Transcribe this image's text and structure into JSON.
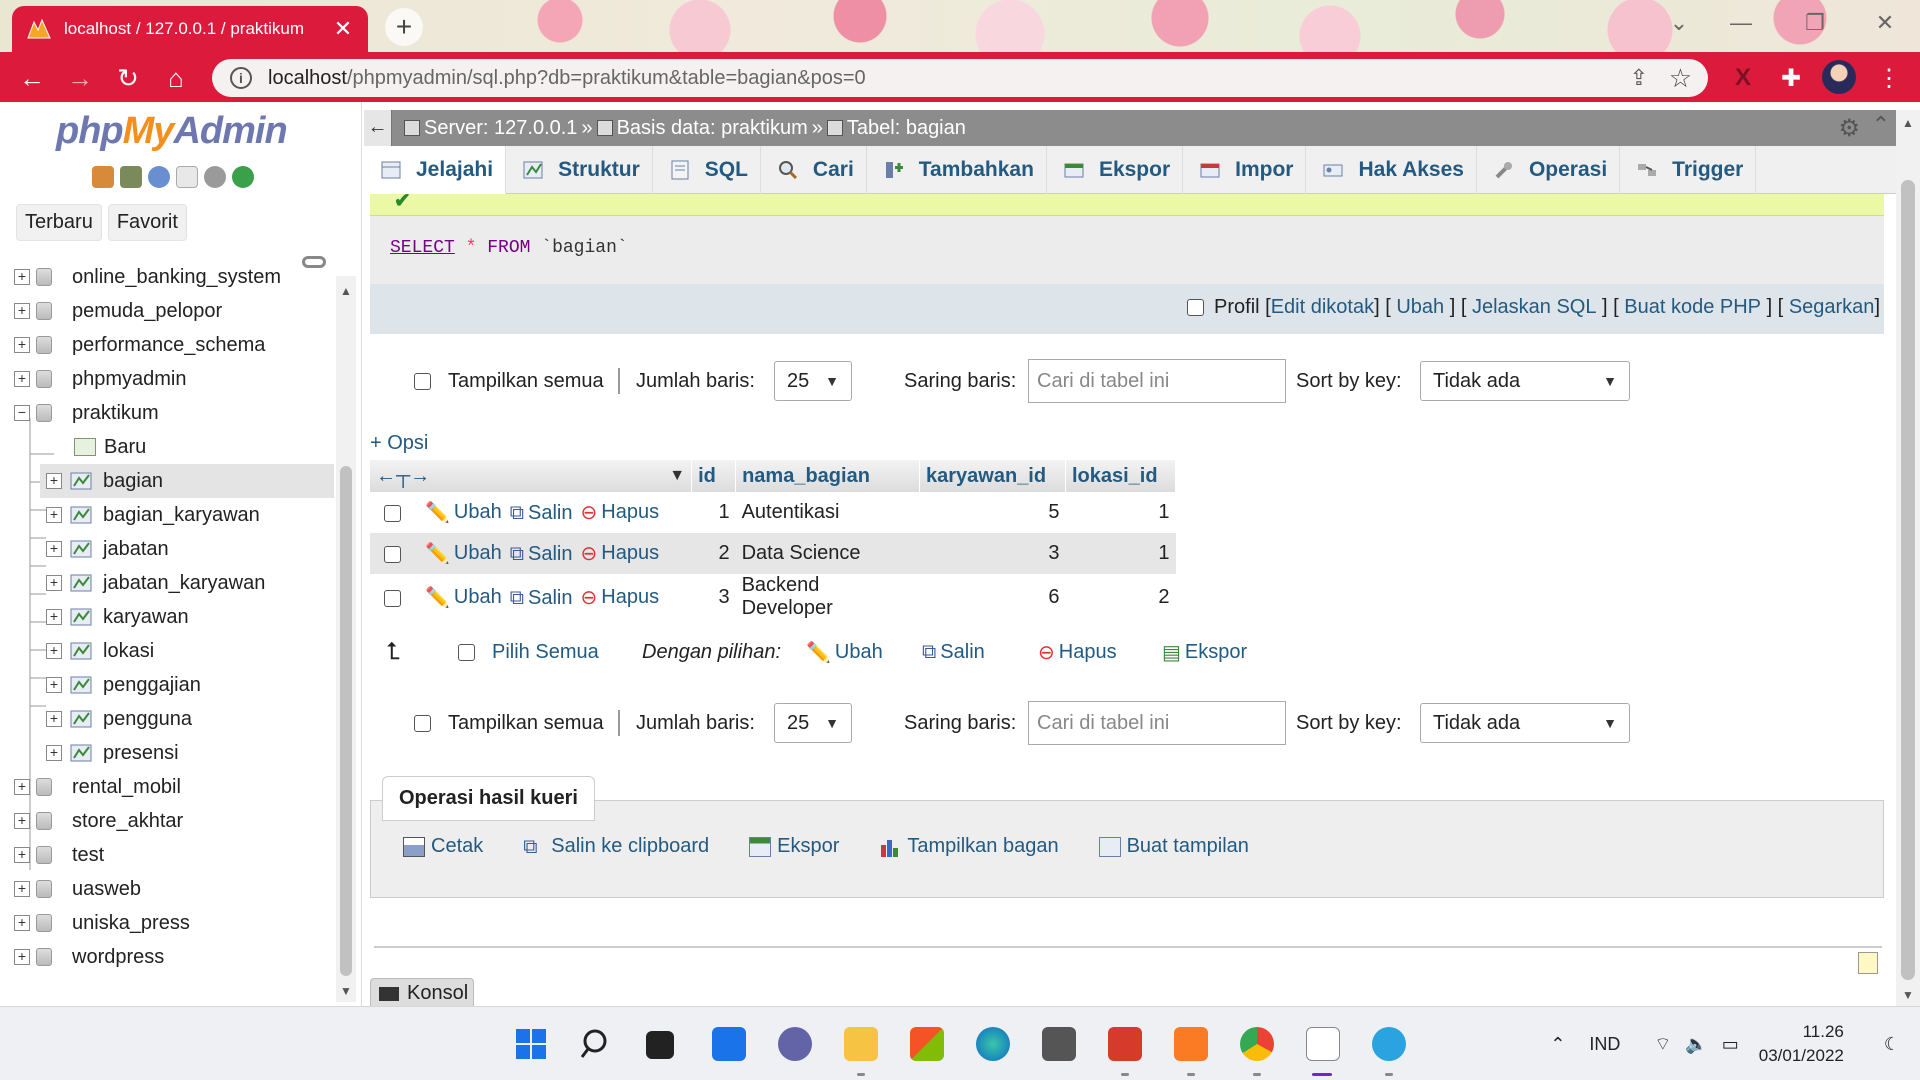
{
  "browser": {
    "tab_title": "localhost / 127.0.0.1 / praktikum",
    "url_host": "localhost",
    "url_path": "/phpmyadmin/sql.php?db=praktikum&table=bagian&pos=0",
    "accent_color": "#dc1b3c"
  },
  "sidebar": {
    "logo": {
      "php": "php",
      "my": "My",
      "admin": "Admin"
    },
    "quick_tabs": [
      "Terbaru",
      "Favorit"
    ],
    "databases": [
      {
        "name": "online_banking_system"
      },
      {
        "name": "pemuda_pelopor"
      },
      {
        "name": "performance_schema"
      },
      {
        "name": "phpmyadmin"
      },
      {
        "name": "praktikum"
      },
      {
        "name": "Baru"
      },
      {
        "name": "bagian"
      },
      {
        "name": "bagian_karyawan"
      },
      {
        "name": "jabatan"
      },
      {
        "name": "jabatan_karyawan"
      },
      {
        "name": "karyawan"
      },
      {
        "name": "lokasi"
      },
      {
        "name": "penggajian"
      },
      {
        "name": "pengguna"
      },
      {
        "name": "presensi"
      },
      {
        "name": "rental_mobil"
      },
      {
        "name": "store_akhtar"
      },
      {
        "name": "test"
      },
      {
        "name": "uasweb"
      },
      {
        "name": "uniska_press"
      },
      {
        "name": "wordpress"
      }
    ]
  },
  "breadcrumb": {
    "server": "Server: 127.0.0.1",
    "database": "Basis data: praktikum",
    "table": "Tabel: bagian",
    "separator": "»"
  },
  "tabs": [
    "Jelajahi",
    "Struktur",
    "SQL",
    "Cari",
    "Tambahkan",
    "Ekspor",
    "Impor",
    "Hak Akses",
    "Operasi",
    "Trigger"
  ],
  "query": {
    "select": "SELECT",
    "star": "*",
    "from": "FROM",
    "table": "`bagian`"
  },
  "query_links": {
    "profil": "Profil",
    "items": [
      "Edit dikotak",
      "Ubah",
      "Jelaskan SQL",
      "Buat kode PHP",
      "Segarkan"
    ]
  },
  "nav": {
    "show_all": "Tampilkan semua",
    "rows_label": "Jumlah baris:",
    "rows_value": "25",
    "filter_label": "Saring baris:",
    "filter_placeholder": "Cari di tabel ini",
    "sort_label": "Sort by key:",
    "sort_value": "Tidak ada"
  },
  "options_link": "+ Opsi",
  "table": {
    "columns": [
      "id",
      "nama_bagian",
      "karyawan_id",
      "lokasi_id"
    ],
    "action_labels": {
      "edit": "Ubah",
      "copy": "Salin",
      "delete": "Hapus"
    },
    "rows": [
      {
        "id": "1",
        "nama_bagian": "Autentikasi",
        "karyawan_id": "5",
        "lokasi_id": "1"
      },
      {
        "id": "2",
        "nama_bagian": "Data Science",
        "karyawan_id": "3",
        "lokasi_id": "1"
      },
      {
        "id": "3",
        "nama_bagian": "Backend Developer",
        "karyawan_id": "6",
        "lokasi_id": "2"
      }
    ]
  },
  "with_selected": {
    "select_all": "Pilih Semua",
    "label": "Dengan pilihan:",
    "edit": "Ubah",
    "copy": "Salin",
    "delete": "Hapus",
    "export": "Ekspor"
  },
  "query_ops": {
    "title": "Operasi hasil kueri",
    "items": [
      "Cetak",
      "Salin ke clipboard",
      "Ekspor",
      "Tampilkan bagan",
      "Buat tampilan"
    ]
  },
  "console": "Konsol",
  "taskbar": {
    "language": "IND",
    "time": "11.26",
    "date": "03/01/2022"
  }
}
